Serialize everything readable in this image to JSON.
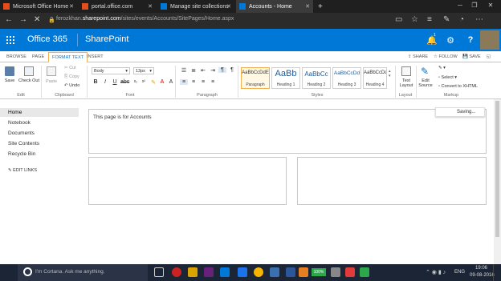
{
  "browser": {
    "tabs": [
      {
        "label": "Microsoft Office Home",
        "icon": "office-icon",
        "color": "#e74c1c"
      },
      {
        "label": "portal.office.com",
        "icon": "office-icon",
        "color": "#e74c1c"
      },
      {
        "label": "Manage site collections",
        "icon": "sharepoint-icon",
        "color": "#0078d7"
      },
      {
        "label": "Accounts - Home",
        "icon": "sharepoint-icon",
        "color": "#0078d7"
      }
    ],
    "new_tab": "+",
    "url_prefix": "ferozkhan.",
    "url_domain": "sharepoint.com",
    "url_path": "/sites/events/Accounts/SitePages/Home.aspx"
  },
  "suite": {
    "app_name": "Office 365",
    "site_name": "SharePoint",
    "notification_count": "1",
    "accent": "#0078d7"
  },
  "ribbon_tabs": [
    "BROWSE",
    "PAGE",
    "FORMAT TEXT",
    "INSERT"
  ],
  "ribbon_actions": {
    "share": "SHARE",
    "follow": "FOLLOW",
    "save": "SAVE"
  },
  "ribbon": {
    "save": "Save",
    "checkout": "Check Out",
    "paste": "Paste",
    "cut": "Cut",
    "copy": "Copy",
    "undo": "Undo",
    "font_name": "Body",
    "font_size": "13px",
    "text_layout": "Text Layout",
    "edit_source": "Edit Source",
    "select": "Select",
    "convert": "Convert to XHTML",
    "groups": {
      "edit": "Edit",
      "clipboard": "Clipboard",
      "font": "Font",
      "paragraph": "Paragraph",
      "styles": "Styles",
      "layout": "Layout",
      "markup": "Markup"
    },
    "styles": [
      {
        "sample": "AaBbCcDdE",
        "name": "Paragraph"
      },
      {
        "sample": "AaBb",
        "name": "Heading 1"
      },
      {
        "sample": "AaBbCc",
        "name": "Heading 2"
      },
      {
        "sample": "AaBbCcDd",
        "name": "Heading 3"
      },
      {
        "sample": "AaBbCcDd",
        "name": "Heading 4"
      }
    ]
  },
  "leftnav": {
    "items": [
      "Home",
      "Notebook",
      "Documents",
      "Site Contents",
      "Recycle Bin"
    ],
    "edit_links": "EDIT LINKS"
  },
  "content": {
    "text": "This page is for Accounts",
    "saving": "Saving..."
  },
  "taskbar": {
    "cortana": "I'm Cortana. Ask me anything.",
    "battery": "100%",
    "lang": "ENG",
    "time": "19:06",
    "date": "09-08-2016"
  }
}
